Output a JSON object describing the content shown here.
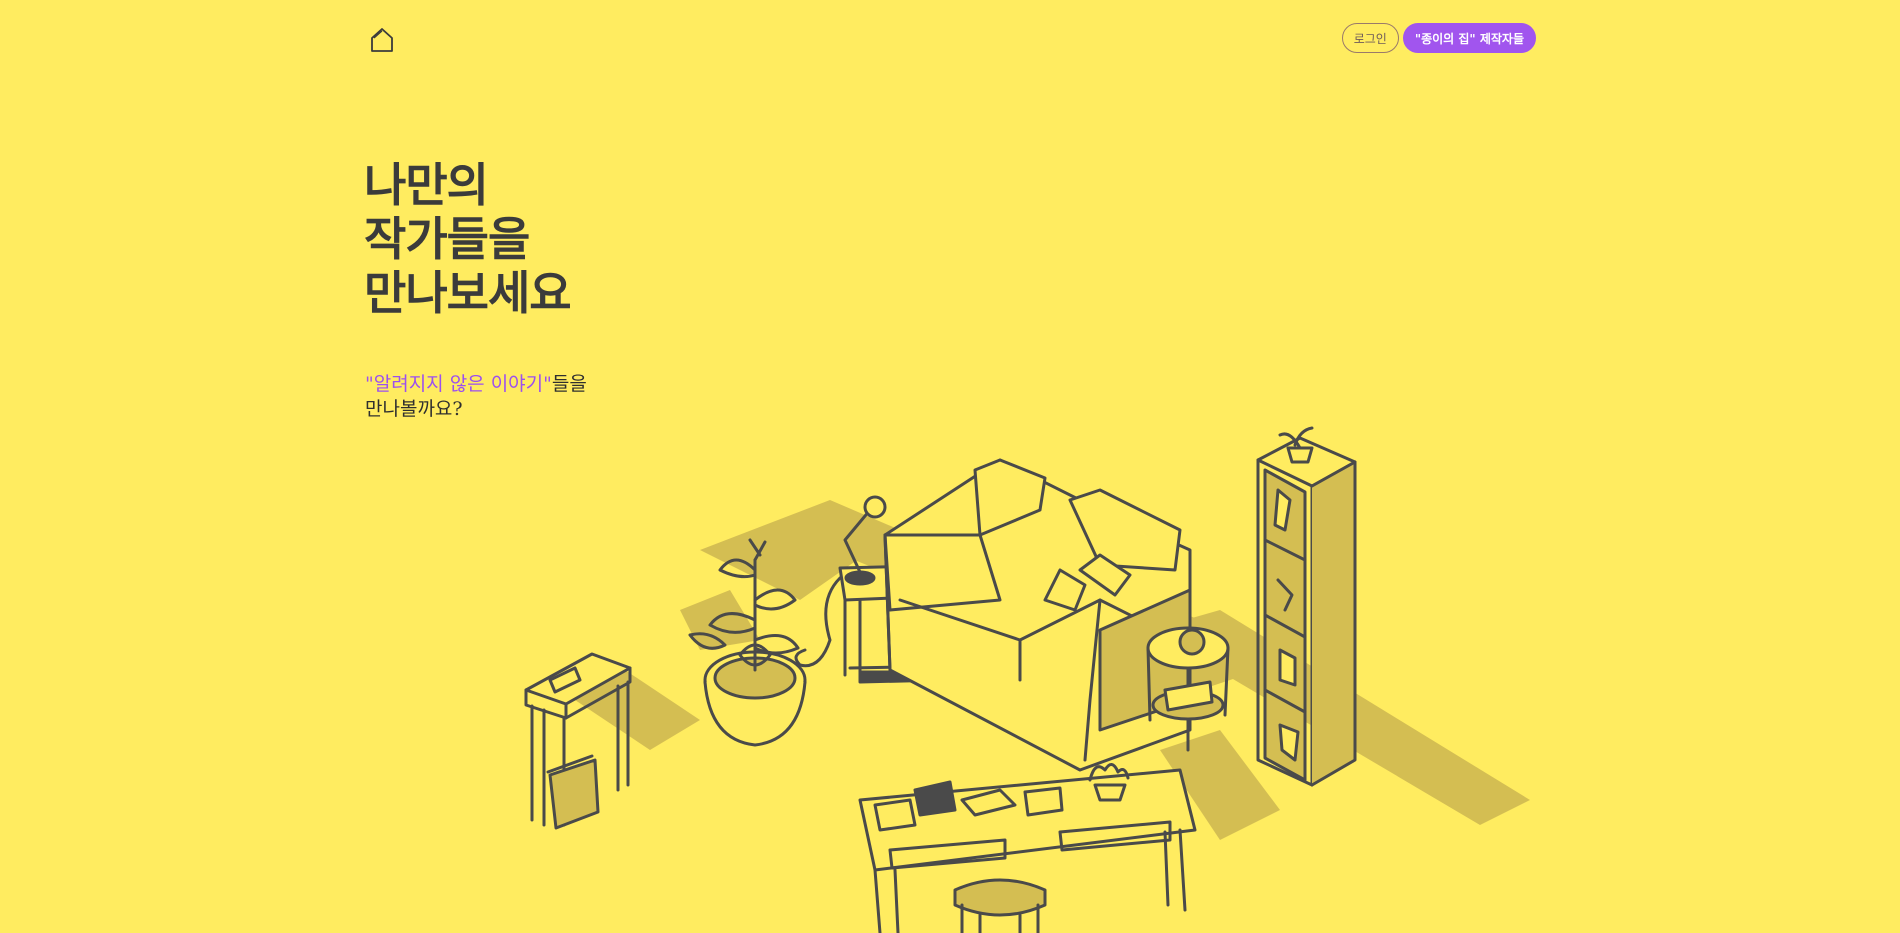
{
  "header": {
    "logo_icon": "house-outline-icon",
    "login_label": "로그인",
    "makers_label": "\"종이의 집\" 제작자들"
  },
  "hero": {
    "title_lines": [
      "나만의",
      "작가들을",
      "만나보세요"
    ],
    "subtitle_accent": "\"알려지지 않은 이야기\"",
    "subtitle_rest": "들을",
    "subtitle_line2": "만나볼까요?"
  },
  "illustration": {
    "description_icon": "isometric-living-room-illustration"
  },
  "colors": {
    "background": "#ffec60",
    "accent": "#a155ee",
    "ink": "#3b3b3b",
    "shadow": "#d4be52"
  }
}
